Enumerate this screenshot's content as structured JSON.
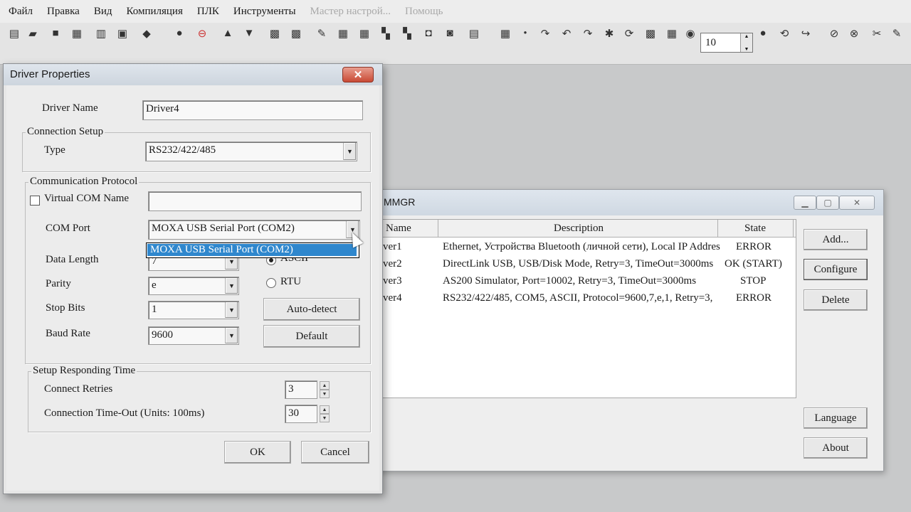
{
  "menubar": {
    "items": [
      "Файл",
      "Правка",
      "Вид",
      "Компиляция",
      "ПЛК",
      "Инструменты",
      "Мастер настрой...",
      "Помощь"
    ]
  },
  "toolbar": {
    "zoom_value": "10"
  },
  "commgr": {
    "title": "MMGR",
    "columns": [
      "Name",
      "Description",
      "State"
    ],
    "rows": [
      {
        "name": "ver1",
        "description": "Ethernet, Устройства Bluetooth (личной сети), Local IP Addres",
        "state": "ERROR"
      },
      {
        "name": "ver2",
        "description": "DirectLink USB, USB/Disk Mode, Retry=3, TimeOut=3000ms",
        "state": "OK (START)"
      },
      {
        "name": "ver3",
        "description": "AS200 Simulator, Port=10002, Retry=3, TimeOut=3000ms",
        "state": "STOP"
      },
      {
        "name": "ver4",
        "description": "RS232/422/485, COM5, ASCII, Protocol=9600,7,e,1, Retry=3,",
        "state": "ERROR"
      }
    ],
    "buttons": {
      "add": "Add...",
      "configure": "Configure",
      "delete": "Delete",
      "language": "Language",
      "about": "About"
    }
  },
  "dialog": {
    "title": "Driver Properties",
    "close_label": "✕",
    "driver_name_label": "Driver Name",
    "driver_name_value": "Driver4",
    "connection_setup": {
      "title": "Connection Setup",
      "type_label": "Type",
      "type_value": "RS232/422/485"
    },
    "protocol": {
      "title": "Communication Protocol",
      "virtual_com_label": "Virtual COM Name",
      "virtual_com_value": "",
      "com_port_label": "COM Port",
      "com_port_value": "MOXA USB Serial Port (COM2)",
      "com_port_option": "MOXA USB Serial Port (COM2)",
      "data_length_label": "Data Length",
      "data_length_value": "7",
      "parity_label": "Parity",
      "parity_value": "e",
      "stop_bits_label": "Stop Bits",
      "stop_bits_value": "1",
      "baud_rate_label": "Baud Rate",
      "baud_rate_value": "9600",
      "mode_ascii": "ASCII",
      "mode_rtu": "RTU",
      "auto_detect": "Auto-detect",
      "default": "Default"
    },
    "responding": {
      "title": "Setup Responding Time",
      "retries_label": "Connect Retries",
      "retries_value": "3",
      "timeout_label": "Connection Time-Out (Units: 100ms)",
      "timeout_value": "30"
    },
    "ok": "OK",
    "cancel": "Cancel"
  }
}
